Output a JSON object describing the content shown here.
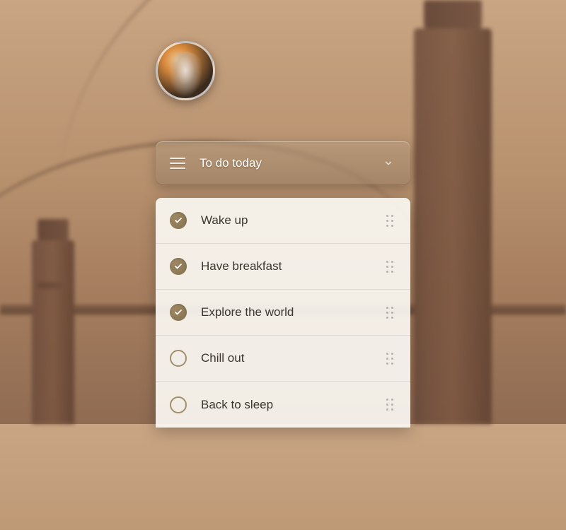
{
  "header": {
    "title": "To do today"
  },
  "tasks": [
    {
      "label": "Wake up",
      "done": true
    },
    {
      "label": "Have breakfast",
      "done": true
    },
    {
      "label": "Explore the world",
      "done": true
    },
    {
      "label": "Chill out",
      "done": false
    },
    {
      "label": "Back to sleep",
      "done": false
    }
  ]
}
